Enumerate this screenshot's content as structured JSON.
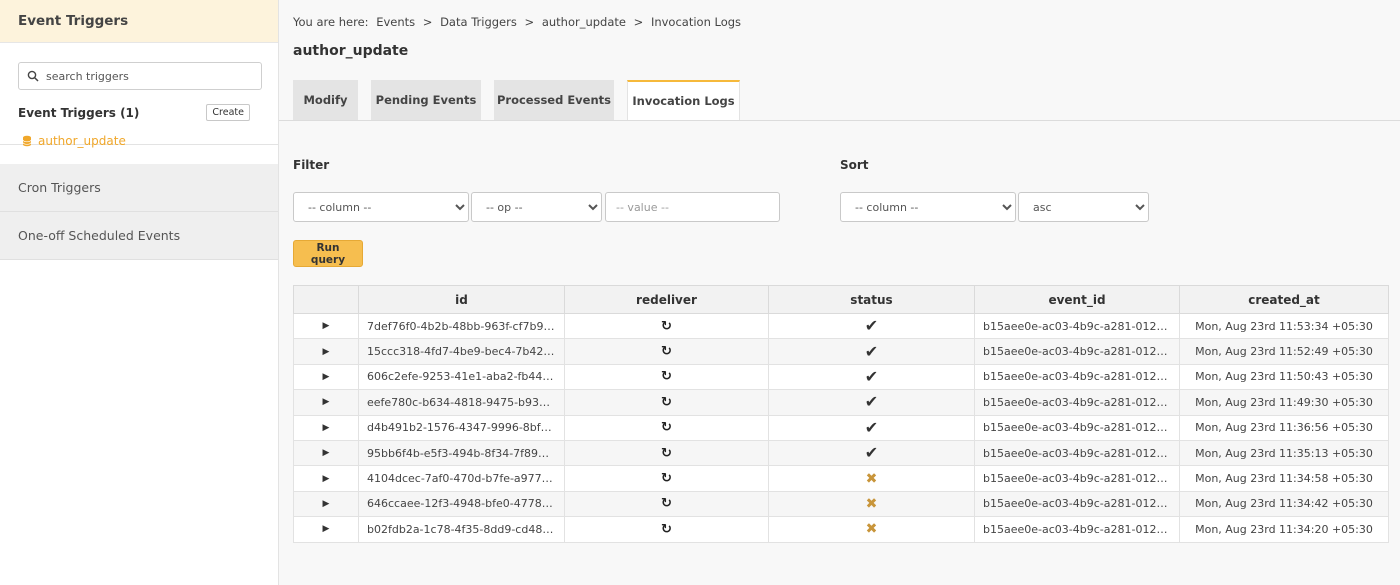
{
  "sidebar": {
    "header": "Event Triggers",
    "search_placeholder": "search triggers",
    "triggers_title": "Event Triggers (1)",
    "create_label": "Create",
    "trigger_name": "author_update",
    "sections": [
      "Cron Triggers",
      "One-off Scheduled Events"
    ]
  },
  "breadcrumb": [
    "You are here:",
    "Events",
    ">",
    "Data Triggers",
    ">",
    "author_update",
    ">",
    "Invocation Logs"
  ],
  "page_title": "author_update",
  "tabs": [
    "Modify",
    "Pending Events",
    "Processed Events",
    "Invocation Logs"
  ],
  "active_tab": "Invocation Logs",
  "filter": {
    "label": "Filter",
    "column": "-- column --",
    "op": "-- op --",
    "value_placeholder": "-- value --"
  },
  "sort": {
    "label": "Sort",
    "column": "-- column --",
    "order": "asc"
  },
  "run_query_label": "Run query",
  "table": {
    "headers": [
      "id",
      "redeliver",
      "status",
      "event_id",
      "created_at"
    ],
    "rows": [
      {
        "id": "7def76f0-4b2b-48bb-963f-cf7b9c0...",
        "status": "success",
        "event_id": "b15aee0e-ac03-4b9c-a281-01244...",
        "created_at": "Mon, Aug 23rd 11:53:34 +05:30"
      },
      {
        "id": "15ccc318-4fd7-4be9-bec4-7b42a5...",
        "status": "success",
        "event_id": "b15aee0e-ac03-4b9c-a281-01244...",
        "created_at": "Mon, Aug 23rd 11:52:49 +05:30"
      },
      {
        "id": "606c2efe-9253-41e1-aba2-fb443d...",
        "status": "success",
        "event_id": "b15aee0e-ac03-4b9c-a281-01244...",
        "created_at": "Mon, Aug 23rd 11:50:43 +05:30"
      },
      {
        "id": "eefe780c-b634-4818-9475-b9302...",
        "status": "success",
        "event_id": "b15aee0e-ac03-4b9c-a281-01244...",
        "created_at": "Mon, Aug 23rd 11:49:30 +05:30"
      },
      {
        "id": "d4b491b2-1576-4347-9996-8bf38...",
        "status": "success",
        "event_id": "b15aee0e-ac03-4b9c-a281-01244...",
        "created_at": "Mon, Aug 23rd 11:36:56 +05:30"
      },
      {
        "id": "95bb6f4b-e5f3-494b-8f34-7f89d9...",
        "status": "success",
        "event_id": "b15aee0e-ac03-4b9c-a281-01244...",
        "created_at": "Mon, Aug 23rd 11:35:13 +05:30"
      },
      {
        "id": "4104dcec-7af0-470d-b7fe-a977c22...",
        "status": "failed",
        "event_id": "b15aee0e-ac03-4b9c-a281-01244...",
        "created_at": "Mon, Aug 23rd 11:34:58 +05:30"
      },
      {
        "id": "646ccaee-12f3-4948-bfe0-4778d6f...",
        "status": "failed",
        "event_id": "b15aee0e-ac03-4b9c-a281-01244...",
        "created_at": "Mon, Aug 23rd 11:34:42 +05:30"
      },
      {
        "id": "b02fdb2a-1c78-4f35-8dd9-cd4894...",
        "status": "failed",
        "event_id": "b15aee0e-ac03-4b9c-a281-01244...",
        "created_at": "Mon, Aug 23rd 11:34:20 +05:30"
      }
    ]
  },
  "colors": {
    "accent": "#f6be4f",
    "link": "#f0a72a",
    "sidebar_header_bg": "#fdf3dc",
    "failed_icon": "#c8953a"
  },
  "icons": {
    "expand": "play-triangle",
    "redeliver": "refresh-icon",
    "success": "check-icon",
    "failed": "cross-icon"
  }
}
